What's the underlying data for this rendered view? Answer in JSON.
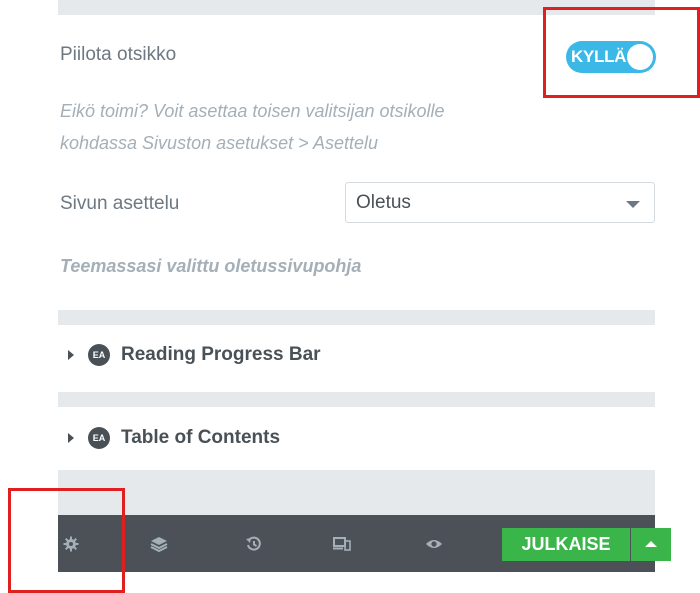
{
  "settings": {
    "hide_title_label": "Piilota otsikko",
    "hide_title_toggle": "KYLLÄ",
    "help_line_1": "Eikö toimi? Voit asettaa toisen valitsijan otsikolle",
    "help_line_2": "kohdassa Sivuston asetukset > Asettelu",
    "page_layout_label": "Sivun asettelu",
    "page_layout_value": "Oletus",
    "theme_note": "Teemassasi valittu oletussivupohja"
  },
  "sections": [
    {
      "badge": "EA",
      "title": "Reading Progress Bar"
    },
    {
      "badge": "EA",
      "title": "Table of Contents"
    }
  ],
  "footer": {
    "icons": [
      "settings-icon",
      "layers-icon",
      "history-icon",
      "responsive-icon",
      "preview-icon"
    ],
    "publish_label": "JULKAISE"
  },
  "colors": {
    "toggle_on": "#3bb8e6",
    "highlight_box": "#e0201f",
    "footer_bg": "#4b5157",
    "publish_green": "#39b54a"
  }
}
